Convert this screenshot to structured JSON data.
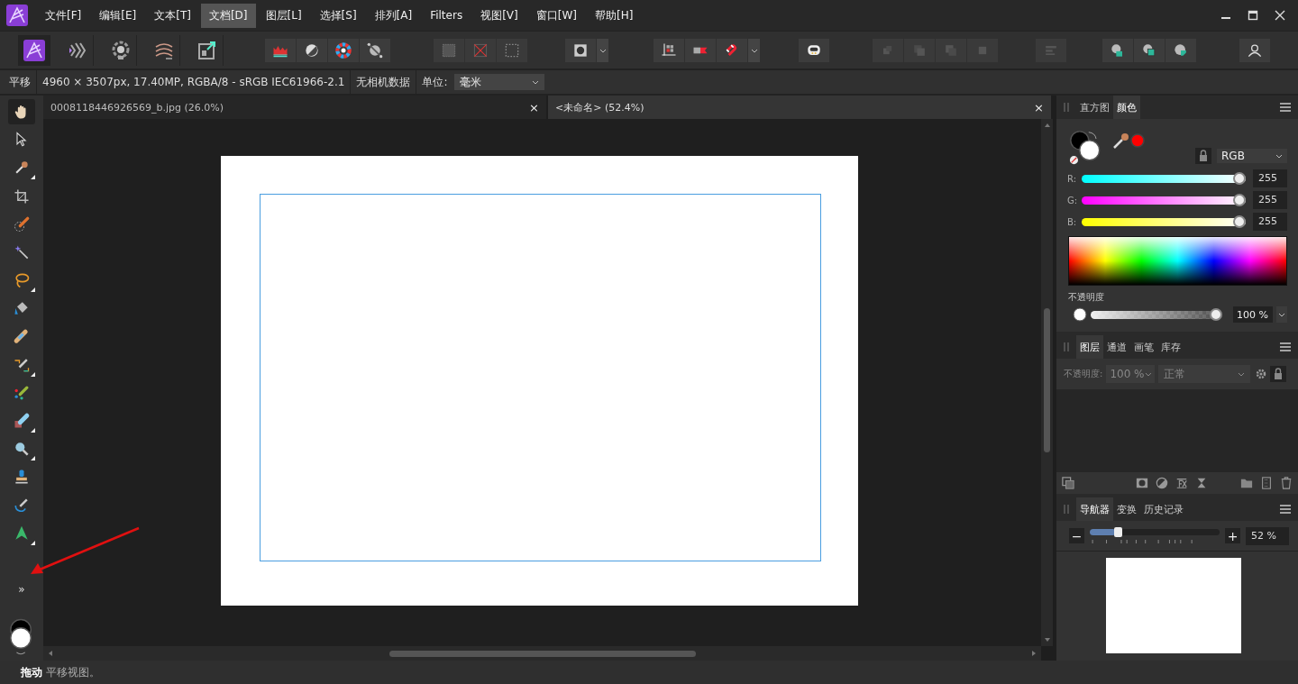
{
  "menu": [
    {
      "label": "文件[F]",
      "selected": false
    },
    {
      "label": "编辑[E]",
      "selected": false
    },
    {
      "label": "文本[T]",
      "selected": false
    },
    {
      "label": "文档[D]",
      "selected": true
    },
    {
      "label": "图层[L]",
      "selected": false
    },
    {
      "label": "选择[S]",
      "selected": false
    },
    {
      "label": "排列[A]",
      "selected": false
    },
    {
      "label": "Filters",
      "selected": false
    },
    {
      "label": "视图[V]",
      "selected": false
    },
    {
      "label": "窗口[W]",
      "selected": false
    },
    {
      "label": "帮助[H]",
      "selected": false
    }
  ],
  "personas": [
    {
      "selected": true
    },
    {
      "selected": false
    },
    {
      "selected": false
    },
    {
      "selected": false
    },
    {
      "selected": false
    }
  ],
  "context_bar": {
    "tool": "平移",
    "info": "4960 × 3507px, 17.40MP, RGBA/8 - sRGB IEC61966-2.1",
    "camera": "无相机数据",
    "unit_label": "单位:",
    "unit_value": "毫米"
  },
  "tools": [
    {
      "selected": true,
      "flyout": false
    },
    {
      "selected": false,
      "flyout": false
    },
    {
      "selected": false,
      "flyout": true
    },
    {
      "selected": false,
      "flyout": false
    },
    {
      "selected": false,
      "flyout": false
    },
    {
      "selected": false,
      "flyout": false
    },
    {
      "selected": false,
      "flyout": true
    },
    {
      "selected": false,
      "flyout": false
    },
    {
      "selected": false,
      "flyout": false
    },
    {
      "selected": false,
      "flyout": true
    },
    {
      "selected": false,
      "flyout": false
    },
    {
      "selected": false,
      "flyout": true
    },
    {
      "selected": false,
      "flyout": true
    },
    {
      "selected": false,
      "flyout": false
    },
    {
      "selected": false,
      "flyout": false
    },
    {
      "selected": false,
      "flyout": true
    }
  ],
  "toolbox_expand": "»",
  "documents": [
    {
      "title": "0008118446926569_b.jpg (26.0%)",
      "close": "×",
      "selected": false
    },
    {
      "title": "<未命名> (52.4%)",
      "close": "×",
      "selected": true
    }
  ],
  "color_panel": {
    "tabs": [
      {
        "label": "直方图",
        "selected": false
      },
      {
        "label": "颜色",
        "selected": true
      }
    ],
    "model": "RGB",
    "channels": [
      {
        "label": "R:",
        "level": 1,
        "value": "255"
      },
      {
        "label": "G:",
        "level": 1,
        "value": "255"
      },
      {
        "label": "B:",
        "level": 1,
        "value": "255"
      }
    ],
    "opacity": {
      "label": "不透明度",
      "level": 1,
      "value": "100 %"
    }
  },
  "layers_panel": {
    "tabs": [
      {
        "label": "图层",
        "selected": true
      },
      {
        "label": "通道",
        "selected": false
      },
      {
        "label": "画笔",
        "selected": false
      },
      {
        "label": "库存",
        "selected": false
      }
    ],
    "opacity_label": "不透明度:",
    "opacity_value": "100 %",
    "blend_mode": "正常"
  },
  "navigator_panel": {
    "tabs": [
      {
        "label": "导航器",
        "selected": true
      },
      {
        "label": "变换",
        "selected": false
      },
      {
        "label": "历史记录",
        "selected": false
      }
    ],
    "zoom_out": "−",
    "zoom": {
      "level": 0.2,
      "value": "52 %"
    },
    "zoom_in": "+"
  },
  "status_bar": "**拖动** 平移视图。"
}
